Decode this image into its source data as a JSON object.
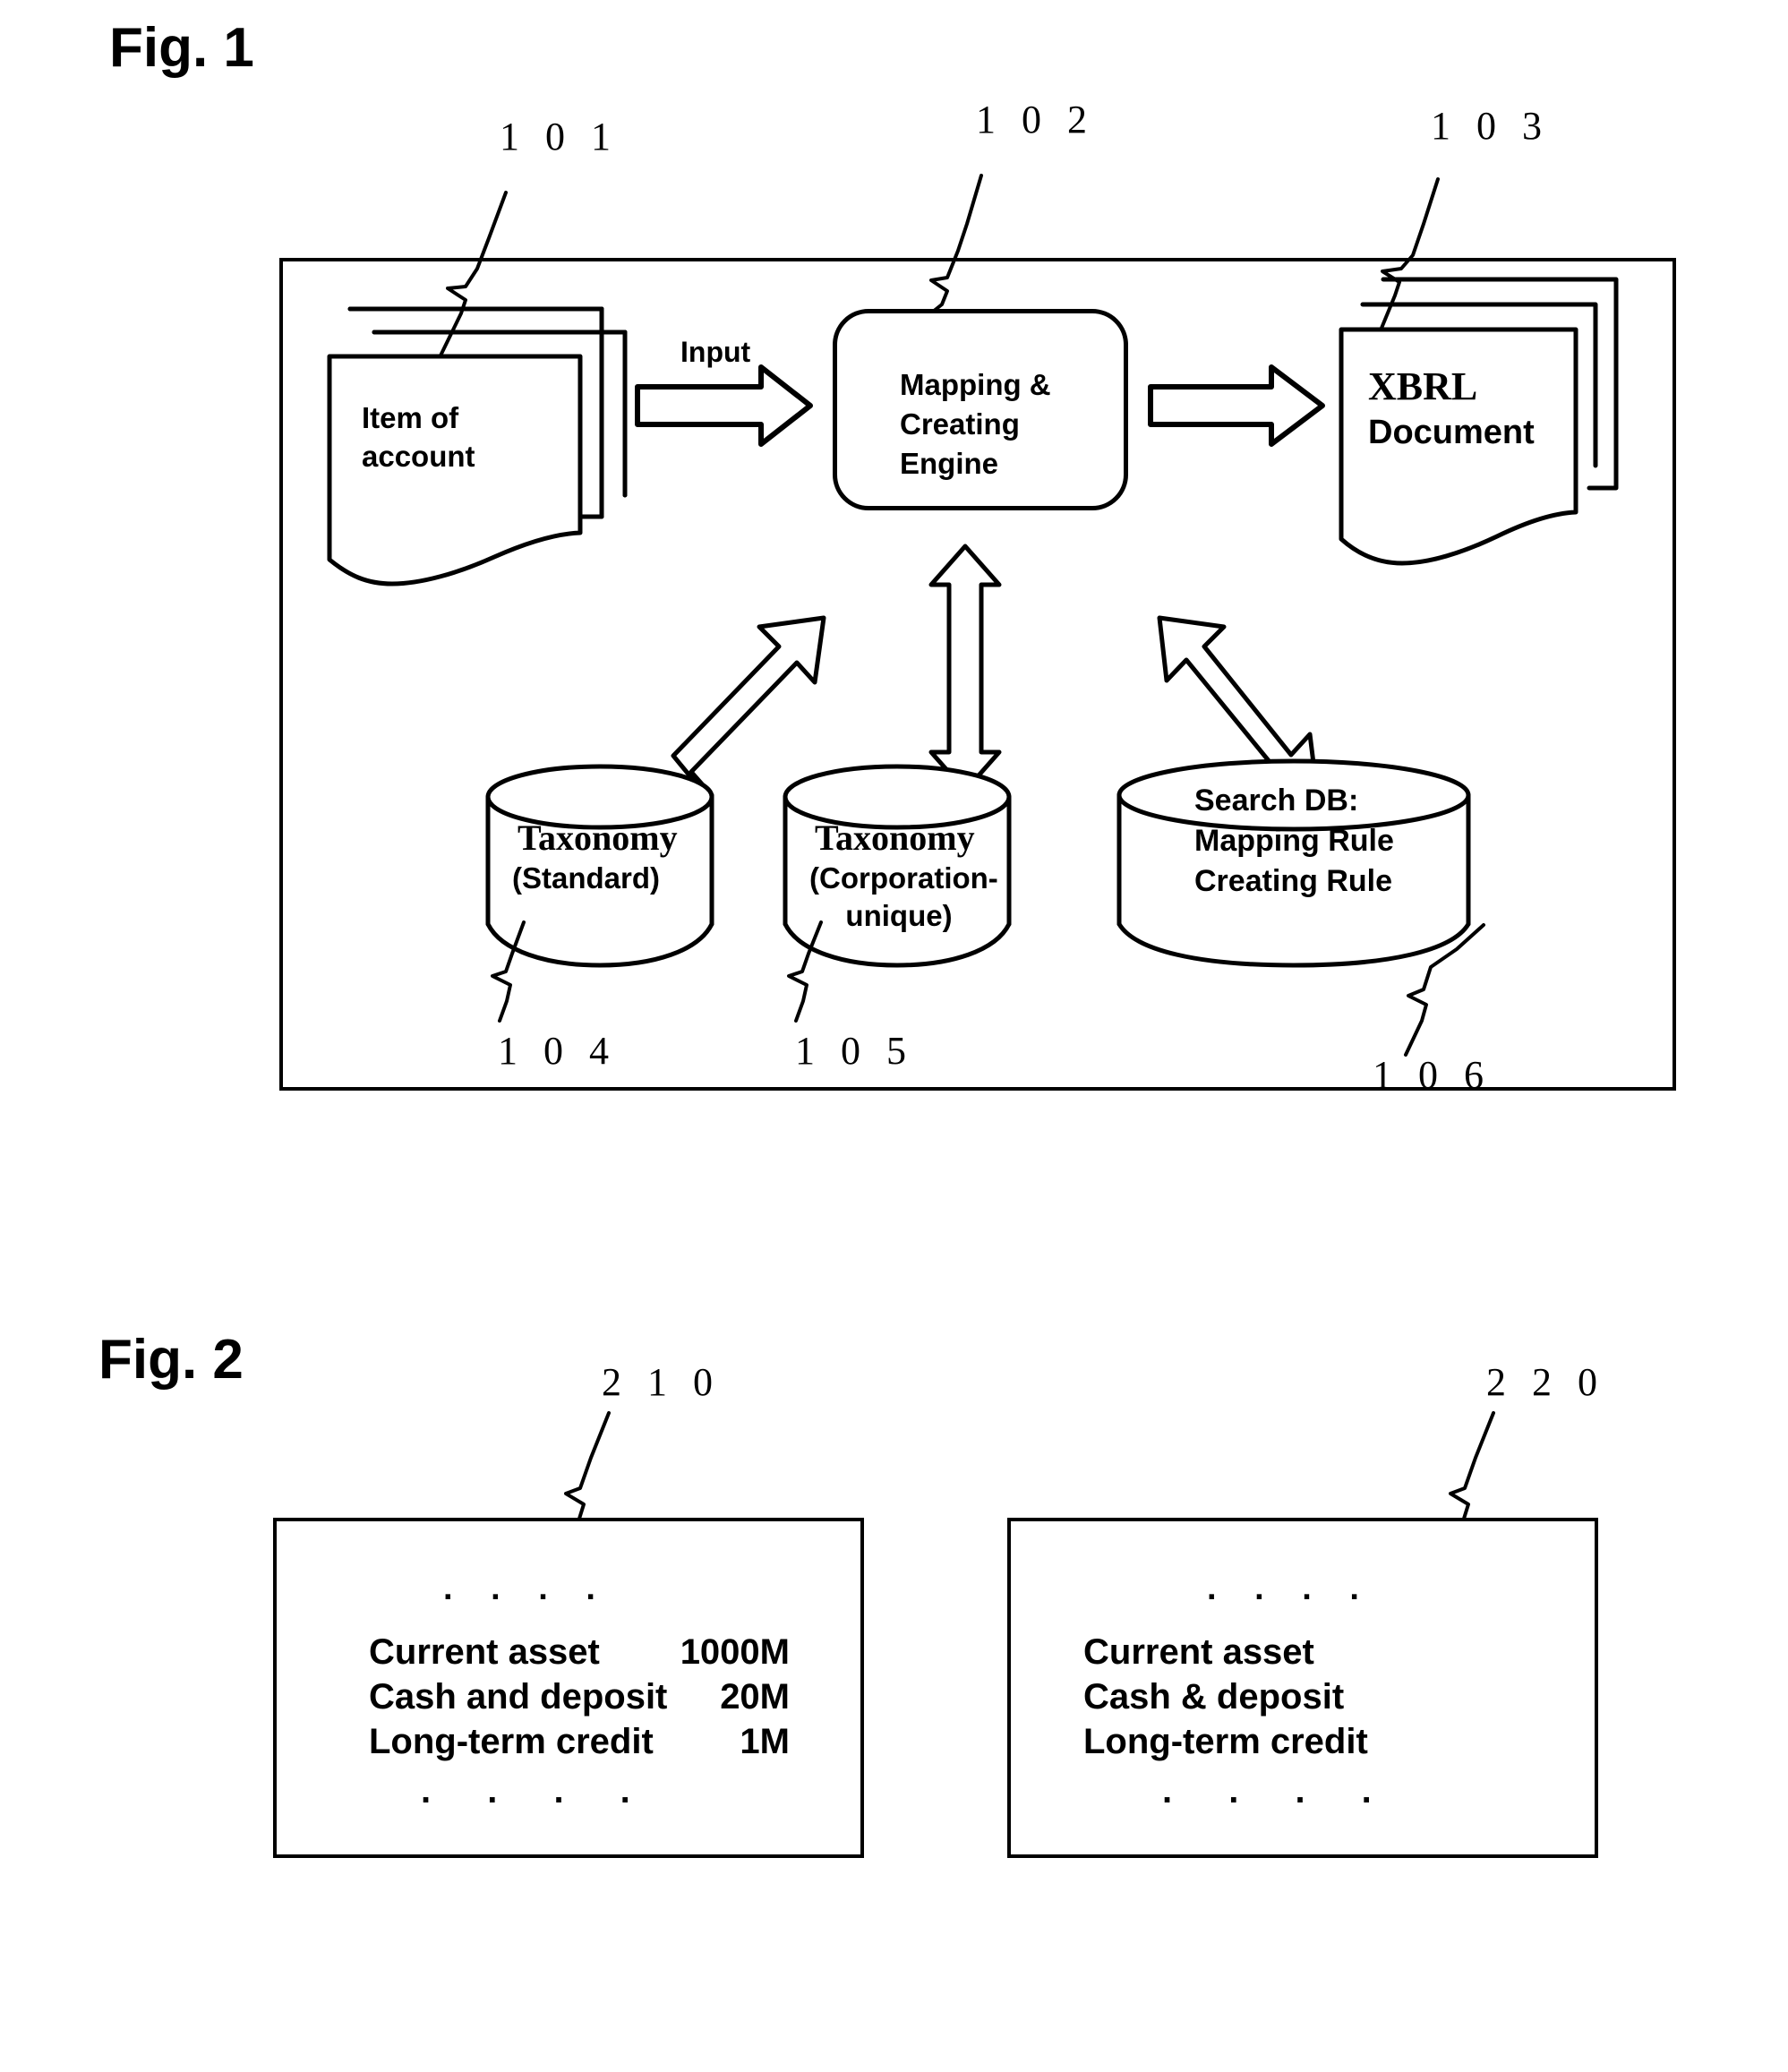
{
  "figures": [
    {
      "caption": "Fig. 1",
      "refs": [
        {
          "id": "101",
          "text": "1 0 1"
        },
        {
          "id": "102",
          "text": "1 0 2"
        },
        {
          "id": "103",
          "text": "1 0 3"
        },
        {
          "id": "104",
          "text": "1 0 4"
        },
        {
          "id": "105",
          "text": "1 0 5"
        },
        {
          "id": "106",
          "text": "1 0 6"
        }
      ],
      "nodes": {
        "input_documents": {
          "label": "Item of\naccount",
          "ref": "101"
        },
        "engine": {
          "label": "Mapping &\nCreating\nEngine",
          "ref": "102"
        },
        "output_documents": {
          "title": "XBRL",
          "subtitle": "Document",
          "ref": "103"
        },
        "taxonomy_standard": {
          "title": "Taxonomy",
          "subtitle": "(Standard)",
          "ref": "104"
        },
        "taxonomy_corporation": {
          "title": "Taxonomy",
          "subtitle": "(Corporation-\nunique)",
          "ref": "105"
        },
        "search_db": {
          "label": "Search DB:\nMapping Rule\nCreating Rule",
          "ref": "106"
        }
      },
      "edges": {
        "input_arrow_label": "Input"
      }
    },
    {
      "caption": "Fig. 2",
      "refs": [
        {
          "id": "210",
          "text": "2 1 0"
        },
        {
          "id": "220",
          "text": "2 2 0"
        }
      ],
      "panels": [
        {
          "ref": "210",
          "dots_top": ". . . .",
          "dots_bottom": ". . . .",
          "has_values": true,
          "rows": [
            {
              "name": "Current asset",
              "value": "1000M"
            },
            {
              "name": "Cash and deposit",
              "value": "20M"
            },
            {
              "name": "Long-term credit",
              "value": "1M"
            }
          ]
        },
        {
          "ref": "220",
          "dots_top": ". . . .",
          "dots_bottom": ". . . .",
          "has_values": false,
          "rows": [
            {
              "name": "Current asset",
              "value": ""
            },
            {
              "name": "Cash & deposit",
              "value": ""
            },
            {
              "name": "Long-term credit",
              "value": ""
            }
          ]
        }
      ]
    }
  ],
  "colors": {
    "ink": "#000000",
    "paper": "#ffffff"
  }
}
